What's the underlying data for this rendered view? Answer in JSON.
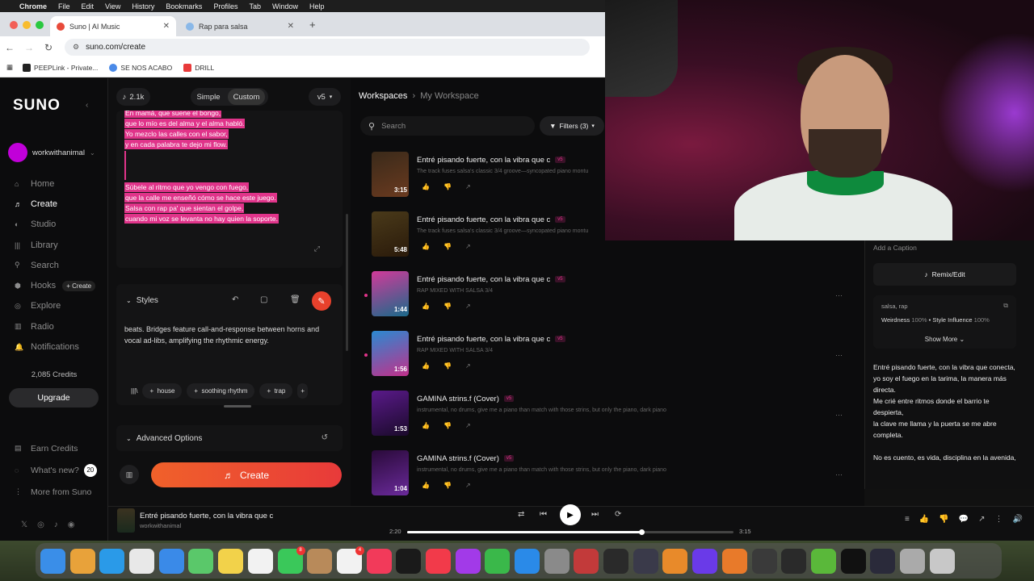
{
  "menubar": {
    "app": "Chrome",
    "items": [
      "File",
      "Edit",
      "View",
      "History",
      "Bookmarks",
      "Profiles",
      "Tab",
      "Window",
      "Help"
    ]
  },
  "browser": {
    "tabs": [
      {
        "title": "Suno | AI Music",
        "active": true
      },
      {
        "title": "Rap para salsa",
        "active": false
      }
    ],
    "url": "suno.com/create",
    "bookmarks": [
      "PEEPLink - Private...",
      "SE NOS ACABO",
      "DRILL"
    ]
  },
  "sidebar": {
    "logo": "SUNO",
    "username": "workwithanimal",
    "nav": [
      {
        "label": "Home",
        "icon": "home-icon",
        "glyph": "⌂",
        "active": false
      },
      {
        "label": "Create",
        "icon": "create-icon",
        "glyph": "♬",
        "active": true
      },
      {
        "label": "Studio",
        "icon": "studio-icon",
        "glyph": "◐",
        "active": false
      },
      {
        "label": "Library",
        "icon": "library-icon",
        "glyph": "|||",
        "active": false
      },
      {
        "label": "Search",
        "icon": "search-icon",
        "glyph": "⚲",
        "active": false
      },
      {
        "label": "Hooks",
        "icon": "hooks-icon",
        "glyph": "⬢",
        "active": false,
        "badge": "+ Create"
      },
      {
        "label": "Explore",
        "icon": "explore-icon",
        "glyph": "◎",
        "active": false
      },
      {
        "label": "Radio",
        "icon": "radio-icon",
        "glyph": "▥",
        "active": false
      },
      {
        "label": "Notifications",
        "icon": "bell-icon",
        "glyph": "🔔",
        "active": false
      }
    ],
    "credits": "2,085 Credits",
    "upgrade": "Upgrade",
    "bottom": [
      {
        "label": "Earn Credits",
        "icon": "earn-icon",
        "glyph": "▤"
      },
      {
        "label": "What's new?",
        "icon": "whats-new-icon",
        "glyph": "◌",
        "count": "20"
      },
      {
        "label": "More from Suno",
        "icon": "more-icon",
        "glyph": "⋮"
      }
    ],
    "socials": [
      "x-icon",
      "instagram-icon",
      "tiktok-icon",
      "discord-icon"
    ]
  },
  "create": {
    "count": "2.1k",
    "mode_simple": "Simple",
    "mode_custom": "Custom",
    "version": "v5",
    "lyrics": [
      "En mamá, que suene el bongo,",
      "que lo mío es del alma y el alma habló.",
      "Yo mezclo las calles con el sabor,",
      "y en cada palabra te dejo mi flow.",
      "",
      "Súbele al ritmo que yo vengo con fuego,",
      "que la calle me enseñó cómo se hace este juego.",
      "Salsa con rap pa' que sientan el golpe,",
      "cuando mi voz se levanta no hay quien la soporte."
    ],
    "styles_label": "Styles",
    "styles_text": "beats. Bridges feature call-and-response between horns and vocal ad-libs, amplifying the rhythmic energy.",
    "tags": [
      "house",
      "soothing rhythm",
      "trap"
    ],
    "advanced": "Advanced Options",
    "create_button": "Create"
  },
  "workspace": {
    "crumb_root": "Workspaces",
    "crumb_current": "My Workspace",
    "search_placeholder": "Search",
    "filters": "Filters (3)",
    "songs": [
      {
        "title": "Entré pisando fuerte, con la vibra que c",
        "version": "v5",
        "desc": "The track fuses salsa's classic 3/4 groove—syncopated piano montu",
        "duration": "3:15",
        "dot": false,
        "colors": [
          "#3a2a1a",
          "#6a3a1f"
        ]
      },
      {
        "title": "Entré pisando fuerte, con la vibra que c",
        "version": "v5",
        "desc": "The track fuses salsa's classic 3/4 groove—syncopated piano montu",
        "duration": "5:48",
        "dot": false,
        "colors": [
          "#4a3a1a",
          "#2a1a0a"
        ]
      },
      {
        "title": "Entré pisando fuerte, con la vibra que c",
        "version": "v5",
        "desc": "RAP MIXED WITH SALSA 3/4",
        "duration": "1:44",
        "dot": true,
        "colors": [
          "#d23a9a",
          "#1a6a8a"
        ]
      },
      {
        "title": "Entré pisando fuerte, con la vibra que c",
        "version": "v5",
        "desc": "RAP MIXED WITH SALSA 3/4",
        "duration": "1:56",
        "dot": true,
        "colors": [
          "#2a8ad2",
          "#c2308a"
        ]
      },
      {
        "title": "GAMINA strins.f (Cover)",
        "version": "v5",
        "desc": "instrumental, no drums, give me a piano than match with those strins, but only the piano, dark piano",
        "duration": "1:53",
        "dot": false,
        "colors": [
          "#5a1a8a",
          "#1a0a2a"
        ]
      },
      {
        "title": "GAMINA strins.f (Cover)",
        "version": "v5",
        "desc": "instrumental, no drums, give me a piano than match with those strins, but only the piano, dark piano",
        "duration": "1:04",
        "dot": false,
        "colors": [
          "#2a0a3a",
          "#6a2a9a"
        ]
      }
    ]
  },
  "detail": {
    "caption": "Add a Caption",
    "remix": "Remix/Edit",
    "style_tags": "salsa, rap",
    "weirdness_label": "Weirdness",
    "weirdness": "100%",
    "influence_label": "Style Influence",
    "influence": "100%",
    "show_more": "Show More",
    "lyrics": [
      "Entré pisando fuerte, con la vibra que conecta,",
      "yo soy el fuego en la tarima, la manera más directa.",
      "Me crié entre ritmos donde el barrio te despierta,",
      "la clave me llama y la puerta se me abre completa.",
      "",
      "No es cuento, es vida, disciplina en la avenida,"
    ]
  },
  "player": {
    "title": "Entré pisando fuerte, con la vibra que c",
    "user": "workwithanimal",
    "elapsed": "2:20",
    "total": "3:15",
    "progress": 0.718
  },
  "dock": {
    "apps": [
      {
        "name": "finder-icon",
        "color": "#3a8ee8"
      },
      {
        "name": "launchpad-icon",
        "color": "#e8a23a"
      },
      {
        "name": "safari-icon",
        "color": "#2a9ae8"
      },
      {
        "name": "chrome-icon",
        "color": "#e8e8e8"
      },
      {
        "name": "mail-icon",
        "color": "#3a8ae8"
      },
      {
        "name": "maps-icon",
        "color": "#5ac86a"
      },
      {
        "name": "notes-icon",
        "color": "#f2d24a"
      },
      {
        "name": "freeform-icon",
        "color": "#f2f2f2"
      },
      {
        "name": "facetime-icon",
        "color": "#3ac85a",
        "badge": "8"
      },
      {
        "name": "contacts-icon",
        "color": "#b88a5a"
      },
      {
        "name": "reminders-icon",
        "color": "#f2f2f2",
        "badge": "4"
      },
      {
        "name": "music-icon",
        "color": "#f23a5a"
      },
      {
        "name": "tv-icon",
        "color": "#1a1a1a"
      },
      {
        "name": "news-icon",
        "color": "#f23a4a"
      },
      {
        "name": "podcasts-icon",
        "color": "#a23ae8"
      },
      {
        "name": "numbers-icon",
        "color": "#3ab84a"
      },
      {
        "name": "appstore-icon",
        "color": "#2a8ae8"
      },
      {
        "name": "settings-icon",
        "color": "#8a8a8a"
      },
      {
        "name": "iphone-mirroring-icon",
        "color": "#c23a3a"
      },
      {
        "name": "logic-icon",
        "color": "#2a2a2a"
      },
      {
        "name": "mainstage-icon",
        "color": "#3a3a4a"
      },
      {
        "name": "fl-studio-icon",
        "color": "#e88a2a"
      },
      {
        "name": "ableton-icon",
        "color": "#6a3ae8"
      },
      {
        "name": "fl-studio-2-icon",
        "color": "#e87a2a"
      },
      {
        "name": "audio-app-icon",
        "color": "#3a3a3a"
      },
      {
        "name": "audio-app-2-icon",
        "color": "#2a2a2a"
      },
      {
        "name": "utorrent-icon",
        "color": "#5ab83a"
      },
      {
        "name": "capcut-icon",
        "color": "#111111"
      },
      {
        "name": "obs-icon",
        "color": "#2a2a3a"
      },
      {
        "name": "preview-icon",
        "color": "#aaaaaa"
      },
      {
        "name": "trash-icon",
        "color": "#c8c8c8"
      }
    ]
  }
}
